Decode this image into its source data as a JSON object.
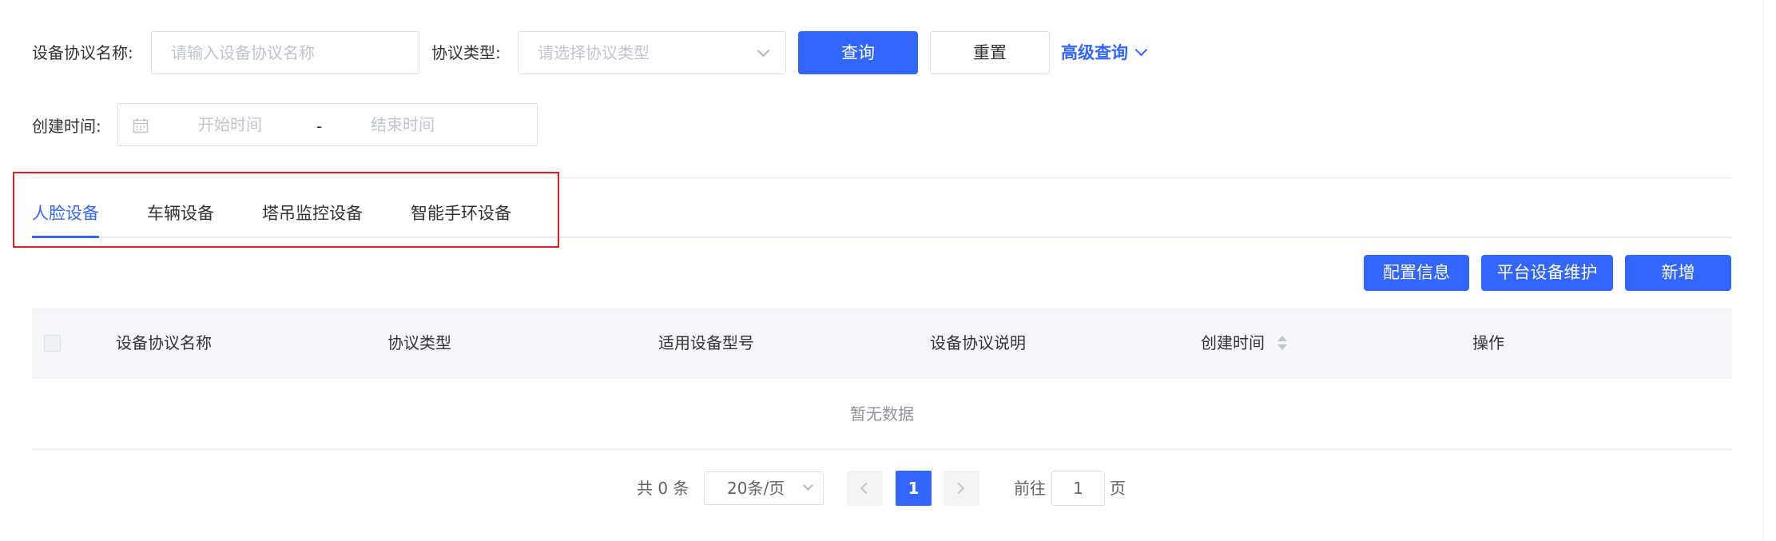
{
  "filters": {
    "protocol_name_label": "设备协议名称:",
    "protocol_name_placeholder": "请输入设备协议名称",
    "protocol_type_label": "协议类型:",
    "protocol_type_placeholder": "请选择协议类型",
    "query_button": "查询",
    "reset_button": "重置",
    "advanced_query": "高级查询",
    "created_time_label": "创建时间:",
    "start_time_placeholder": "开始时间",
    "range_separator": "-",
    "end_time_placeholder": "结束时间"
  },
  "tabs": [
    {
      "label": "人脸设备",
      "active": true
    },
    {
      "label": "车辆设备",
      "active": false
    },
    {
      "label": "塔吊监控设备",
      "active": false
    },
    {
      "label": "智能手环设备",
      "active": false
    }
  ],
  "toolbar": {
    "config_button": "配置信息",
    "platform_button": "平台设备维护",
    "add_button": "新增"
  },
  "table": {
    "columns": [
      "设备协议名称",
      "协议类型",
      "适用设备型号",
      "设备协议说明",
      "创建时间",
      "操作"
    ],
    "empty_text": "暂无数据"
  },
  "pagination": {
    "total": "共 0 条",
    "page_size": "20条/页",
    "current_page": "1",
    "goto_label": "前往",
    "goto_value": "1",
    "page_suffix": "页"
  },
  "colors": {
    "primary": "#3366ff",
    "highlight_box": "#e02020",
    "header_bg": "#f5f6fa"
  }
}
